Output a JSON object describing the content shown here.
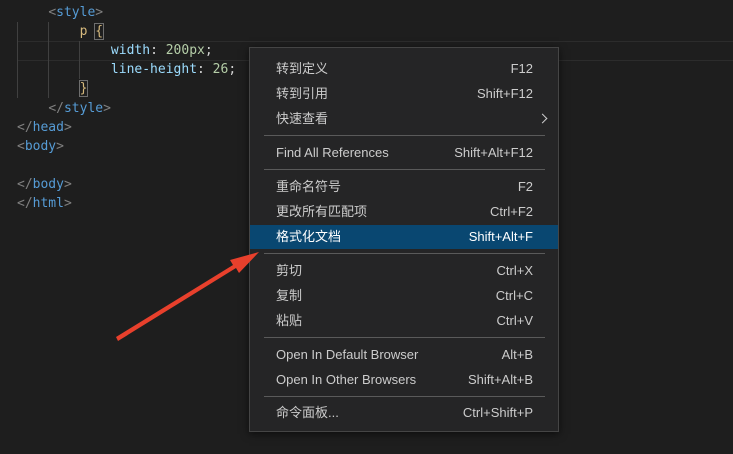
{
  "code": {
    "lines": [
      {
        "indent": "    ",
        "parts": [
          [
            "punc",
            "<"
          ],
          [
            "tag",
            "style"
          ],
          [
            "punc",
            ">"
          ]
        ]
      },
      {
        "indent": "        ",
        "parts": [
          [
            "sel",
            "p"
          ],
          [
            "text",
            " "
          ],
          [
            "brace",
            "{"
          ]
        ]
      },
      {
        "indent": "            ",
        "parts": [
          [
            "prop",
            "width"
          ],
          [
            "text",
            ": "
          ],
          [
            "num",
            "200px"
          ],
          [
            "text",
            ";"
          ]
        ]
      },
      {
        "indent": "            ",
        "parts": [
          [
            "prop",
            "line-height"
          ],
          [
            "text",
            ": "
          ],
          [
            "num",
            "26"
          ],
          [
            "text",
            ";"
          ]
        ]
      },
      {
        "indent": "        ",
        "parts": [
          [
            "brace",
            "}"
          ]
        ]
      },
      {
        "indent": "    ",
        "parts": [
          [
            "punc",
            "</"
          ],
          [
            "tag",
            "style"
          ],
          [
            "punc",
            ">"
          ]
        ]
      },
      {
        "indent": "",
        "parts": [
          [
            "punc",
            "</"
          ],
          [
            "tag",
            "head"
          ],
          [
            "punc",
            ">"
          ]
        ]
      },
      {
        "indent": "",
        "parts": [
          [
            "punc",
            "<"
          ],
          [
            "tag",
            "body"
          ],
          [
            "punc",
            ">"
          ]
        ]
      },
      {
        "indent": "",
        "parts": []
      },
      {
        "indent": "",
        "parts": [
          [
            "punc",
            "</"
          ],
          [
            "tag",
            "body"
          ],
          [
            "punc",
            ">"
          ]
        ]
      },
      {
        "indent": "",
        "parts": [
          [
            "punc",
            "</"
          ],
          [
            "tag",
            "html"
          ],
          [
            "punc",
            ">"
          ]
        ]
      }
    ]
  },
  "context_menu": {
    "items": [
      {
        "id": "goto-definition",
        "label": "转到定义",
        "key": "F12"
      },
      {
        "id": "goto-references",
        "label": "转到引用",
        "key": "Shift+F12"
      },
      {
        "id": "peek",
        "label": "快速查看",
        "key": ""
      },
      {
        "id": "find-all-references",
        "label": "Find All References",
        "key": "Shift+Alt+F12"
      },
      {
        "id": "rename-symbol",
        "label": "重命名符号",
        "key": "F2"
      },
      {
        "id": "change-all-occurrences",
        "label": "更改所有匹配项",
        "key": "Ctrl+F2"
      },
      {
        "id": "format-document",
        "label": "格式化文档",
        "key": "Shift+Alt+F"
      },
      {
        "id": "cut",
        "label": "剪切",
        "key": "Ctrl+X"
      },
      {
        "id": "copy",
        "label": "复制",
        "key": "Ctrl+C"
      },
      {
        "id": "paste",
        "label": "粘贴",
        "key": "Ctrl+V"
      },
      {
        "id": "open-default-browser",
        "label": "Open In Default Browser",
        "key": "Alt+B"
      },
      {
        "id": "open-other-browsers",
        "label": "Open In Other Browsers",
        "key": "Shift+Alt+B"
      },
      {
        "id": "command-palette",
        "label": "命令面板...",
        "key": "Ctrl+Shift+P"
      }
    ],
    "active_item": "format-document",
    "submenu_icon": "chevron-right-icon"
  },
  "colors": {
    "editor_bg": "#1e1e1e",
    "menu_bg": "#252526",
    "menu_highlight": "#094771",
    "annotation_arrow": "#e8402c"
  }
}
